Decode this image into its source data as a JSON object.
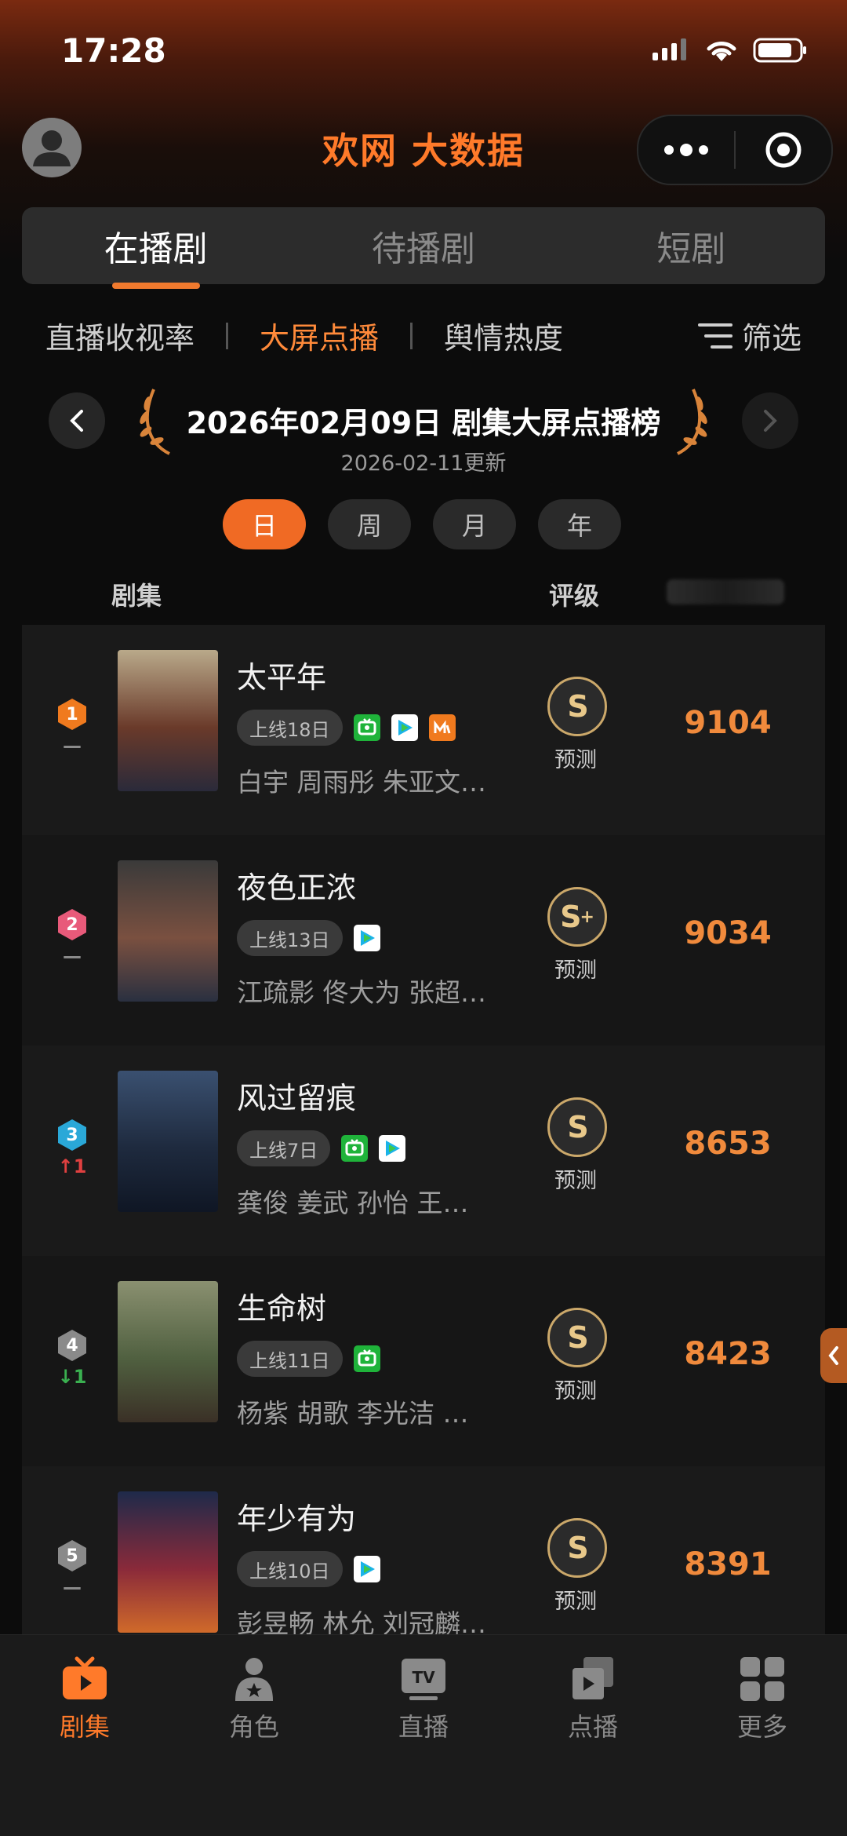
{
  "status_bar": {
    "time": "17:28"
  },
  "header": {
    "brand": "欢网 大数据"
  },
  "main_tabs": [
    {
      "label": "在播剧",
      "active": true
    },
    {
      "label": "待播剧",
      "active": false
    },
    {
      "label": "短剧",
      "active": false
    }
  ],
  "sub_tabs": [
    {
      "label": "直播收视率",
      "active": false
    },
    {
      "label": "大屏点播",
      "active": true
    },
    {
      "label": "舆情热度",
      "active": false
    }
  ],
  "filter_label": "筛选",
  "chart": {
    "title": "2026年02月09日 剧集大屏点播榜",
    "updated": "2026-02-11更新"
  },
  "periods": [
    {
      "label": "日",
      "active": true
    },
    {
      "label": "周",
      "active": false
    },
    {
      "label": "月",
      "active": false
    },
    {
      "label": "年",
      "active": false
    }
  ],
  "columns": {
    "series": "剧集",
    "grade": "评级"
  },
  "rows": [
    {
      "rank": "1",
      "rank_color": "#f07a1e",
      "change": "—",
      "change_color": "#8a8a8a",
      "title": "太平年",
      "online": "上线18日",
      "platforms": [
        "iqiyi",
        "tencent",
        "mgtv"
      ],
      "cast": "白宇 周雨彤 朱亚文…",
      "grade": "S",
      "grade_plus": "",
      "grade_sub": "预测",
      "score": "9104",
      "poster_colors": [
        "#b9a98a",
        "#6a3a2a",
        "#2a2a3a"
      ]
    },
    {
      "rank": "2",
      "rank_color": "#e85a7a",
      "change": "—",
      "change_color": "#8a8a8a",
      "title": "夜色正浓",
      "online": "上线13日",
      "platforms": [
        "tencent"
      ],
      "cast": "江疏影 佟大为 张超…",
      "grade": "S",
      "grade_plus": "+",
      "grade_sub": "预测",
      "score": "9034",
      "poster_colors": [
        "#3a3a3a",
        "#7a5040",
        "#2a3040"
      ]
    },
    {
      "rank": "3",
      "rank_color": "#2aa8d8",
      "change": "↑1",
      "change_color": "#e04040",
      "title": "风过留痕",
      "online": "上线7日",
      "platforms": [
        "iqiyi",
        "tencent"
      ],
      "cast": "龚俊 姜武 孙怡 王…",
      "grade": "S",
      "grade_plus": "",
      "grade_sub": "预测",
      "score": "8653",
      "poster_colors": [
        "#3a5070",
        "#1e2a3e",
        "#0f1624"
      ]
    },
    {
      "rank": "4",
      "rank_color": "#8a8a8a",
      "change": "↓1",
      "change_color": "#3ab050",
      "title": "生命树",
      "online": "上线11日",
      "platforms": [
        "iqiyi"
      ],
      "cast": "杨紫 胡歌 李光洁 …",
      "grade": "S",
      "grade_plus": "",
      "grade_sub": "预测",
      "score": "8423",
      "poster_colors": [
        "#8a9070",
        "#506040",
        "#3a3026"
      ]
    },
    {
      "rank": "5",
      "rank_color": "#8a8a8a",
      "change": "—",
      "change_color": "#8a8a8a",
      "title": "年少有为",
      "online": "上线10日",
      "platforms": [
        "tencent"
      ],
      "cast": "彭昱畅 林允 刘冠麟…",
      "grade": "S",
      "grade_plus": "",
      "grade_sub": "预测",
      "score": "8391",
      "poster_colors": [
        "#1e2a4a",
        "#8a2a3a",
        "#d06a2a"
      ]
    }
  ],
  "bottom_nav": [
    {
      "label": "剧集",
      "icon": "tv-play-icon",
      "active": true
    },
    {
      "label": "角色",
      "icon": "person-star-icon",
      "active": false
    },
    {
      "label": "直播",
      "icon": "tv-live-icon",
      "active": false
    },
    {
      "label": "点播",
      "icon": "play-stack-icon",
      "active": false
    },
    {
      "label": "更多",
      "icon": "grid-icon",
      "active": false
    }
  ]
}
